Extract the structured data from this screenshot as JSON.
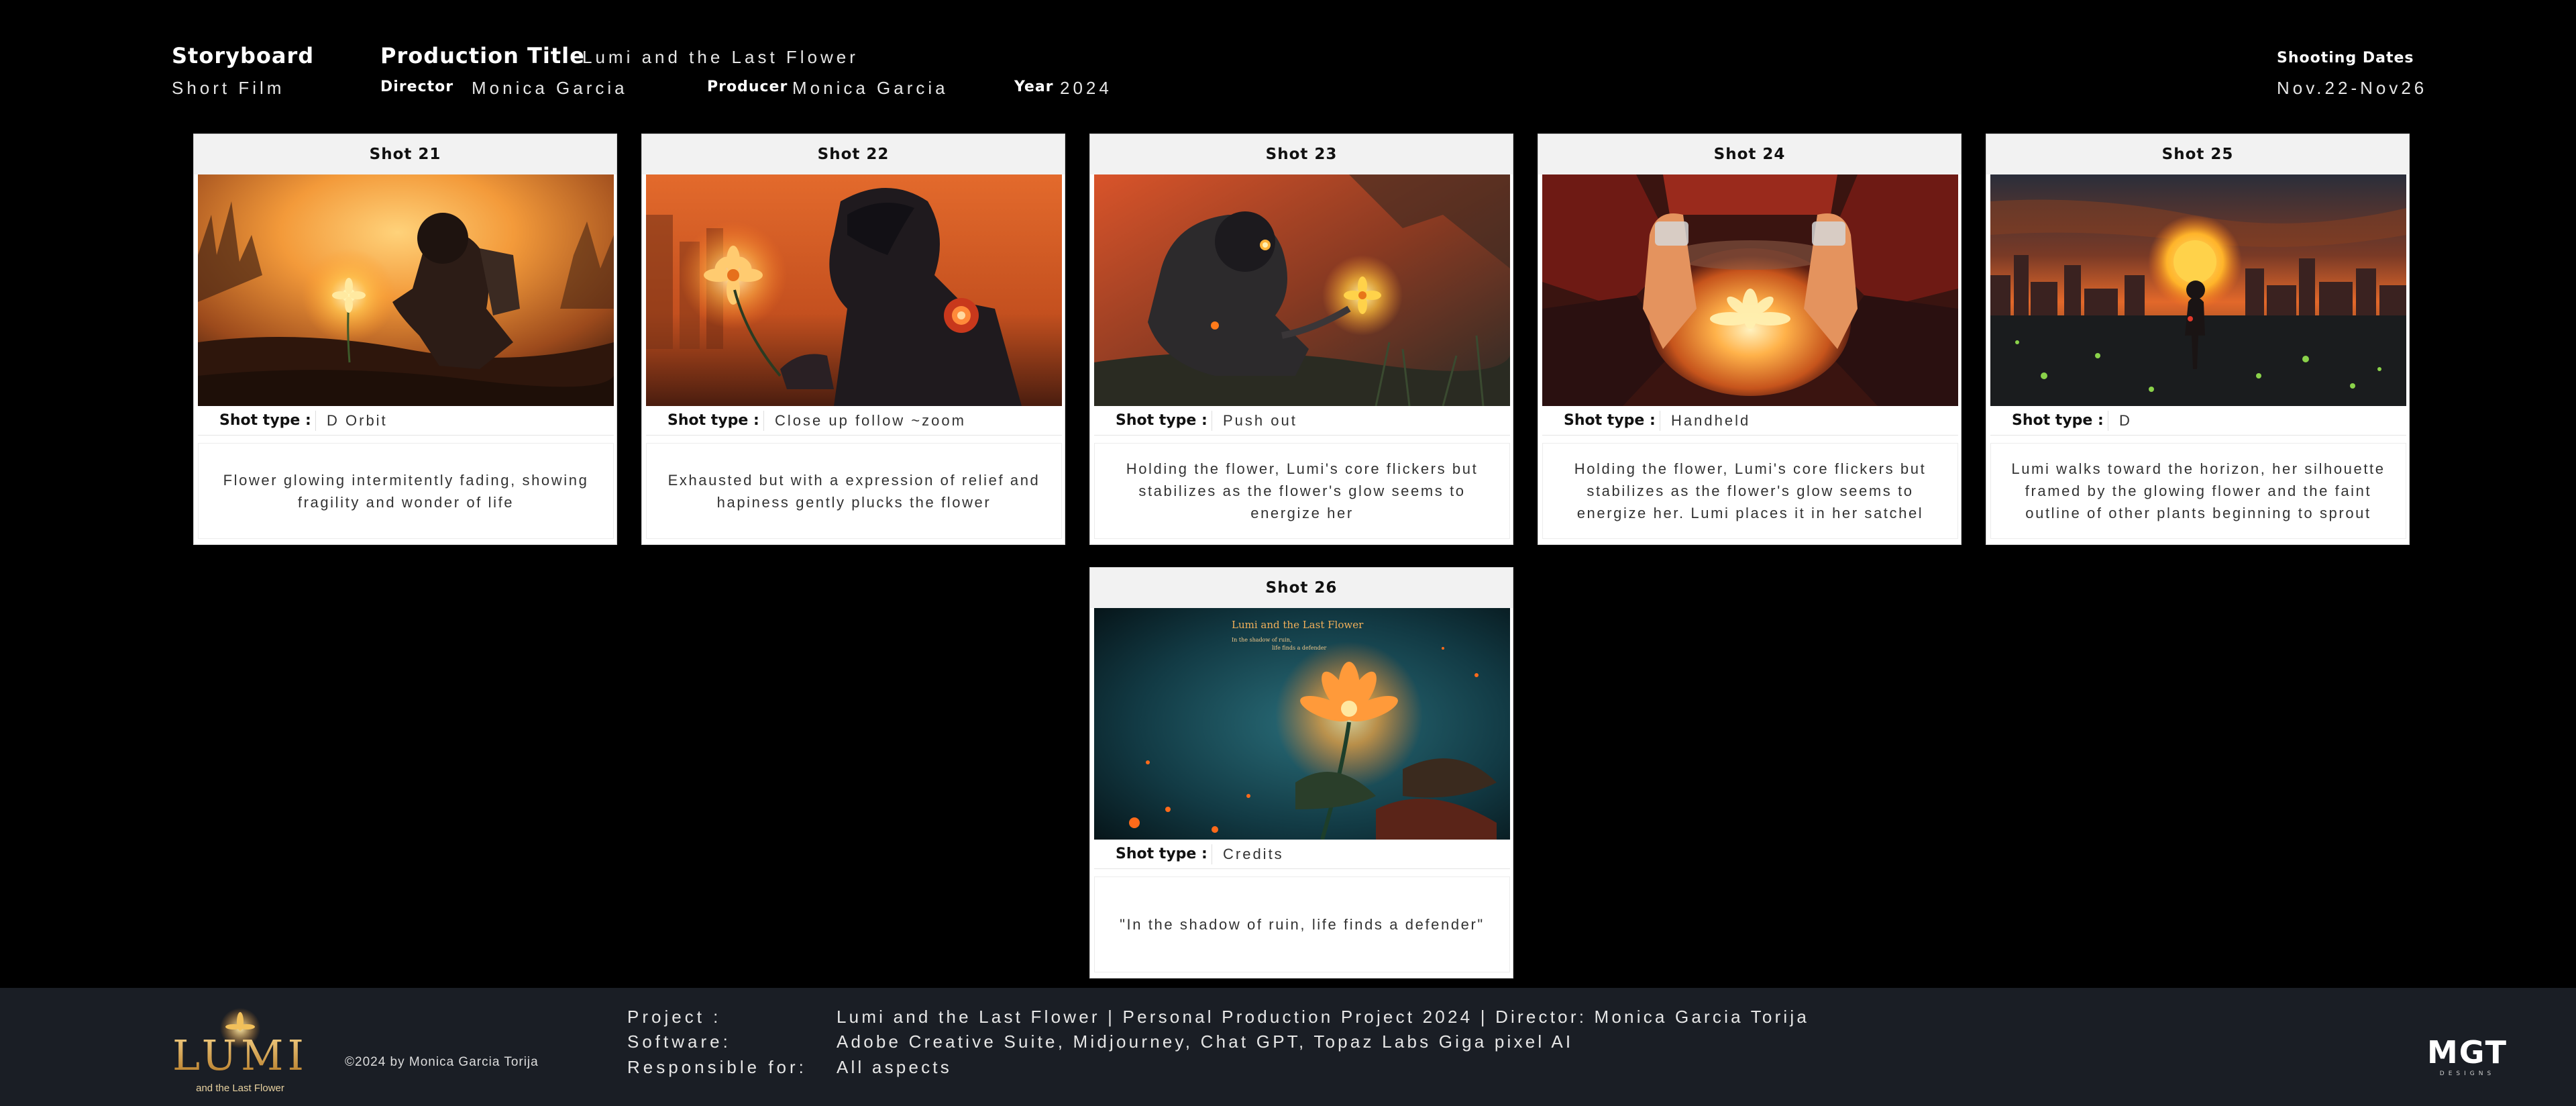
{
  "header": {
    "storyboard_label": "Storyboard",
    "film_type": "Short Film",
    "production_title_label": "Production Title",
    "production_title": "Lumi and the Last Flower",
    "director_label": "Director",
    "director": "Monica Garcia",
    "producer_label": "Producer",
    "producer": "Monica Garcia",
    "year_label": "Year",
    "year": "2024",
    "shooting_dates_label": "Shooting Dates",
    "shooting_dates": "Nov.22-Nov26"
  },
  "shot_type_label": "Shot type :",
  "shots": [
    {
      "title": "Shot 21",
      "shot_type": "D Orbit",
      "description": "Flower glowing intermitently fading, showing fragility and wonder of life",
      "image": "child-kneeling-by-glowing-flower"
    },
    {
      "title": "Shot 22",
      "shot_type": "Close up follow ~zoom",
      "description": "Exhausted but with a expression of relief and hapiness gently plucks the flower",
      "image": "child-holding-flower-closeup"
    },
    {
      "title": "Shot 23",
      "shot_type": "Push out",
      "description": "Holding the flower, Lumi's core flickers but stabilizes as the flower's glow seems to energize her",
      "image": "robot-child-with-flower"
    },
    {
      "title": "Shot 24",
      "shot_type": "Handheld",
      "description": "Holding the flower, Lumi's core flickers but stabilizes as the flower's glow seems to energize her. Lumi places it in her satchel",
      "image": "hands-holding-glowing-jar"
    },
    {
      "title": "Shot 25",
      "shot_type": "D",
      "description": "Lumi walks toward the horizon, her silhouette framed by the glowing flower and the faint outline of other plants beginning to sprout",
      "image": "silhouette-walking-to-sunset-city"
    },
    {
      "title": "Shot 26",
      "shot_type": "Credits",
      "description": "\"In the shadow of ruin, life finds a defender\"",
      "image": "title-card-glowing-flower",
      "image_text": {
        "title": "Lumi and the Last Flower",
        "line1": "In the shadow of ruin,",
        "line2": "life finds a defender"
      }
    }
  ],
  "footer": {
    "logo_text": "LUMI",
    "logo_subtext": "and the Last Flower",
    "copyright": "©2024  by Monica Garcia Torija",
    "project_label": "Project :",
    "project": "Lumi and the Last Flower | Personal Production Project 2024 | Director: Monica Garcia Torija",
    "software_label": "Software:",
    "software": "Adobe Creative Suite, Midjourney, Chat GPT, Topaz Labs Giga pixel AI",
    "responsible_label": "Responsible for:",
    "responsible": "All aspects",
    "studio_logo": "MGT",
    "studio_sub": "DESIGNS"
  },
  "colors": {
    "background": "#000000",
    "card": "#ffffff",
    "card_header": "#f2f2f2",
    "footer": "#1a1e25",
    "glow_orange": "#ff8a2a",
    "teal": "#1c6f7a"
  }
}
